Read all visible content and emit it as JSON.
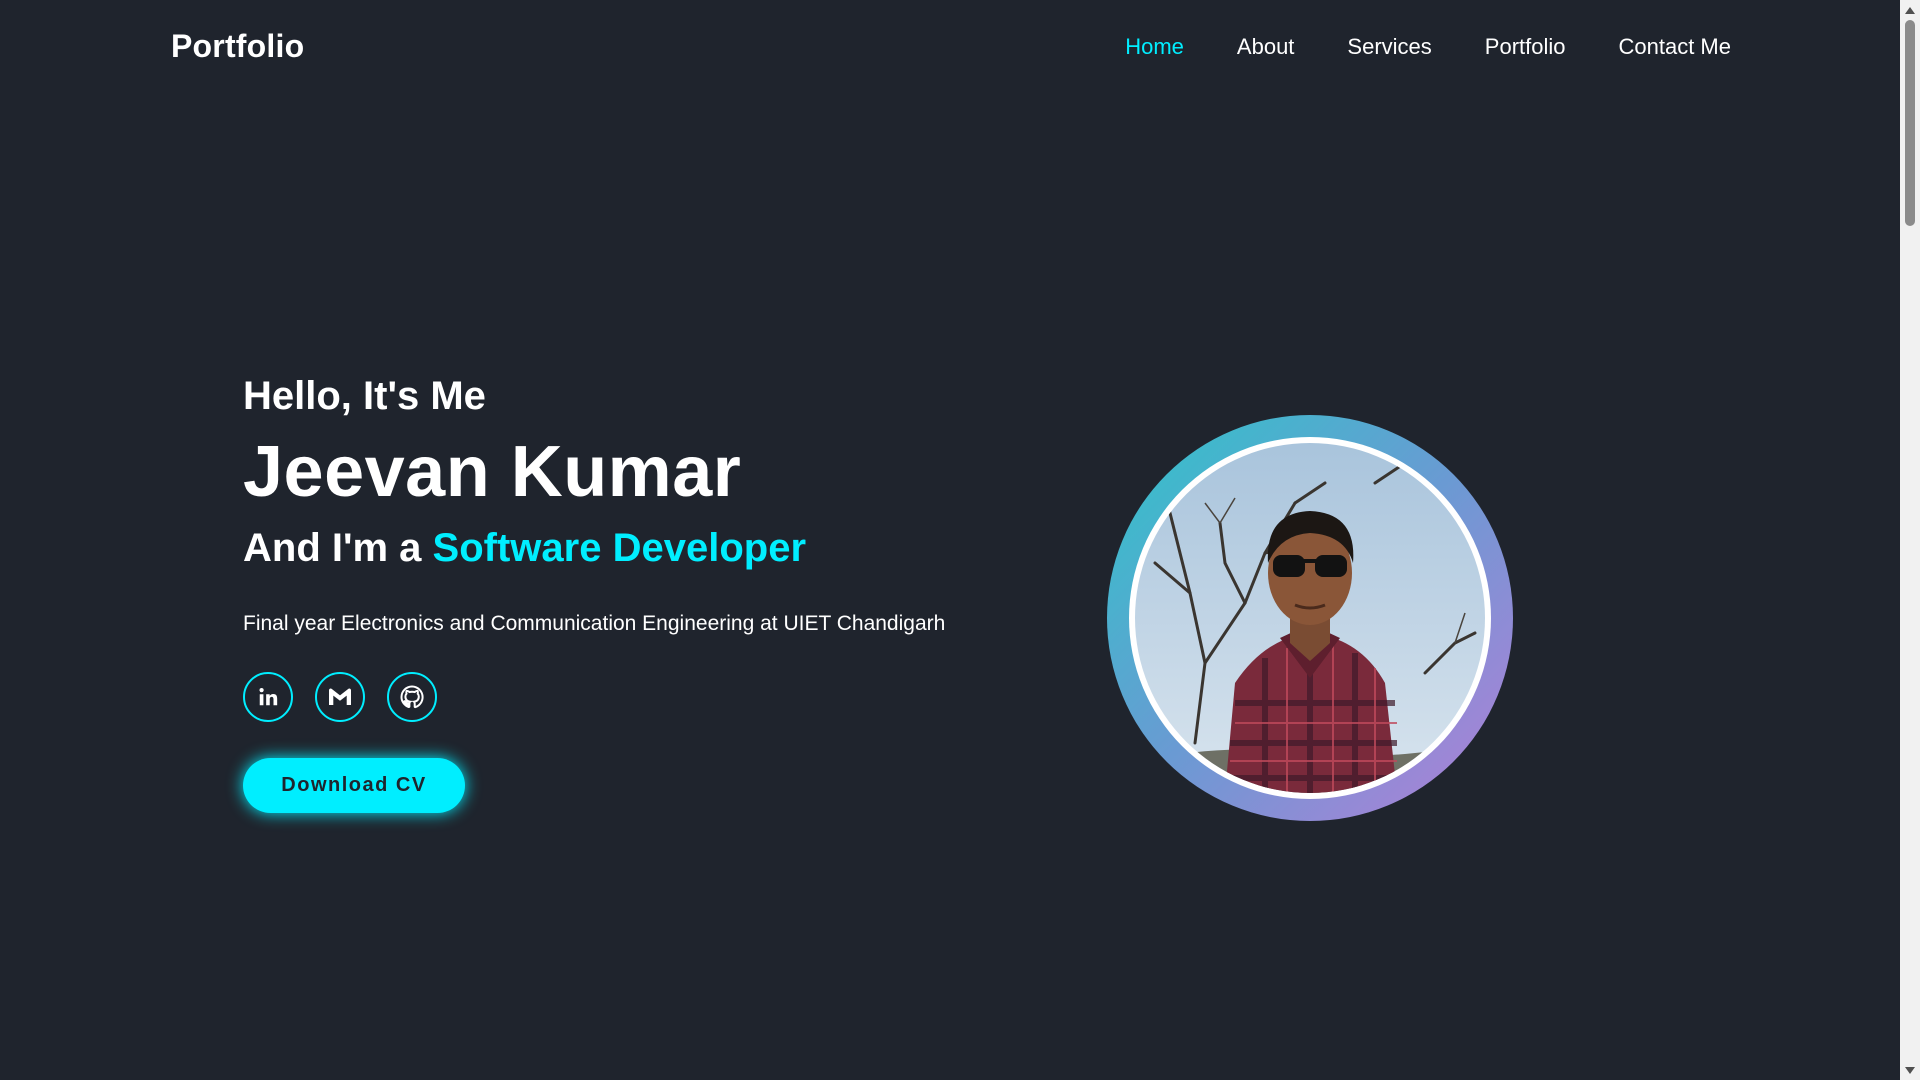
{
  "header": {
    "logo": "Portfolio",
    "nav": [
      {
        "label": "Home",
        "active": true
      },
      {
        "label": "About",
        "active": false
      },
      {
        "label": "Services",
        "active": false
      },
      {
        "label": "Portfolio",
        "active": false
      },
      {
        "label": "Contact Me",
        "active": false
      }
    ]
  },
  "hero": {
    "greeting": "Hello, It's Me",
    "name": "Jeevan Kumar",
    "role_prefix": "And I'm a",
    "role_highlight": "Software Developer",
    "description": "Final year Electronics and Communication Engineering at UIET Chandigarh",
    "socials": [
      {
        "icon": "linkedin-icon"
      },
      {
        "icon": "gmail-icon"
      },
      {
        "icon": "github-icon"
      }
    ],
    "cta_label": "Download CV"
  },
  "avatar": {
    "alt": "profile-photo"
  },
  "colors": {
    "background": "#1f242d",
    "accent": "#00eeff",
    "text": "#ffffff",
    "ring_start": "#2ec5c9",
    "ring_end": "#b47ed8"
  }
}
